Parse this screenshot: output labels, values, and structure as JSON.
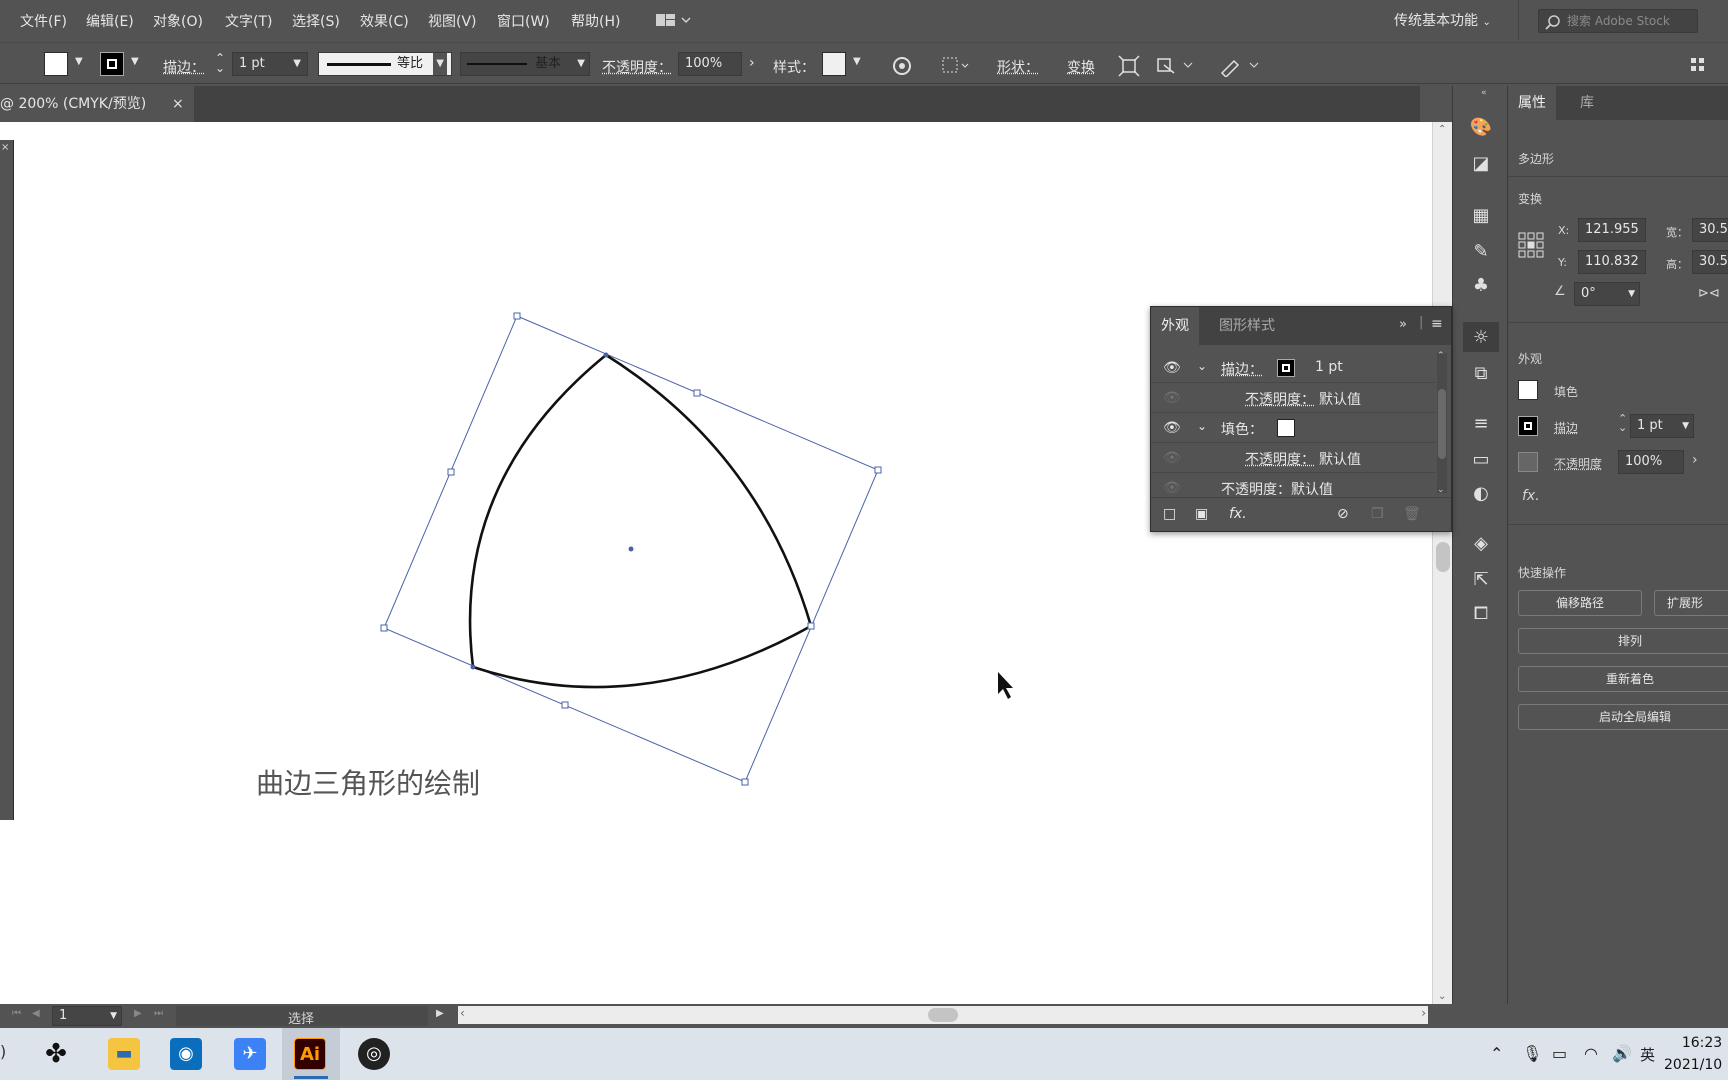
{
  "menu": {
    "items": [
      "文件(F)",
      "编辑(E)",
      "对象(O)",
      "文字(T)",
      "选择(S)",
      "效果(C)",
      "视图(V)",
      "窗口(W)",
      "帮助(H)"
    ],
    "workspace": "传统基本功能",
    "search_placeholder": "搜索 Adobe Stock"
  },
  "control": {
    "stroke_label": "描边：",
    "stroke_weight": "1 pt",
    "profile_label": "等比",
    "brush_label": "基本",
    "opacity_label": "不透明度：",
    "opacity_value": "100%",
    "style_label": "样式：",
    "shape_label": "形状：",
    "transform_label": "变换"
  },
  "document": {
    "tab_label": "@ 200% (CMYK/预览)",
    "close": "×",
    "caption": "曲边三角形的绘制"
  },
  "status": {
    "page": "1",
    "mode": "选择"
  },
  "appearance": {
    "tab_active": "外观",
    "tab_other": "图形样式",
    "stroke_label": "描边：",
    "stroke_value": "1 pt",
    "opacity_label": "不透明度：",
    "opacity_value": "默认值",
    "fill_label": "填色：",
    "opacity2_label": "不透明度：",
    "opacity2_value": "默认值",
    "opacity3_text": "不透明度：默认值"
  },
  "properties": {
    "tab_active": "属性",
    "tab_other": "库",
    "object_type": "多边形",
    "transform_title": "变换",
    "x_label": "X:",
    "x_value": "121.955",
    "y_label": "Y:",
    "y_value": "110.832",
    "w_label": "宽：",
    "w_value": "30.5",
    "h_label": "高：",
    "h_value": "30.5",
    "angle_value": "0°",
    "appearance_title": "外观",
    "fill_label": "填色",
    "stroke_label": "描边",
    "stroke_value": "1 pt",
    "opacity_label": "不透明度",
    "opacity_value": "100%",
    "fx": "fx.",
    "quick_title": "快速操作",
    "btn_offset": "偏移路径",
    "btn_expand": "扩展形",
    "btn_arrange": "排列",
    "btn_recolor": "重新着色",
    "btn_global": "启动全局编辑"
  },
  "taskbar": {
    "ai_label": "Ai",
    "ime": "英",
    "time": "16:23",
    "date": "2021/10"
  },
  "colors": {
    "ui_bg": "#535353",
    "panel_dark": "#424242",
    "selection": "#4a62a8",
    "ai_orange": "#ff9a00",
    "ai_bg": "#330000"
  }
}
